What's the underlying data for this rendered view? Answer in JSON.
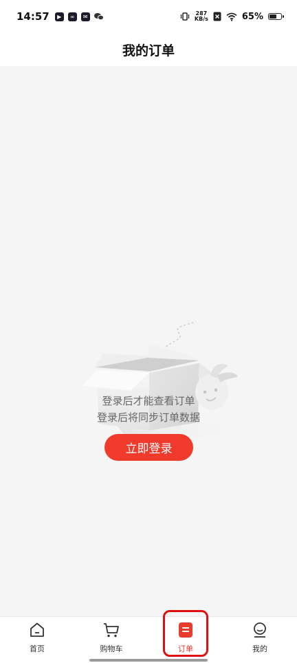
{
  "status_bar": {
    "time": "14:57",
    "net_speed_value": "287",
    "net_speed_unit": "KB/s",
    "battery_percent": "65%",
    "battery_level": 0.65
  },
  "header": {
    "title": "我的订单"
  },
  "empty_state": {
    "line1": "登录后才能查看订单",
    "line2": "登录后将同步订单数据",
    "login_button": "立即登录"
  },
  "tab_bar": {
    "items": [
      {
        "label": "首页",
        "icon": "home-icon"
      },
      {
        "label": "购物车",
        "icon": "cart-icon"
      },
      {
        "label": "订单",
        "icon": "order-icon",
        "active": true
      },
      {
        "label": "我的",
        "icon": "profile-icon"
      }
    ]
  },
  "colors": {
    "accent": "#f03a2c",
    "active_tab_text": "#e8332a",
    "highlight_outline": "#e01010"
  }
}
